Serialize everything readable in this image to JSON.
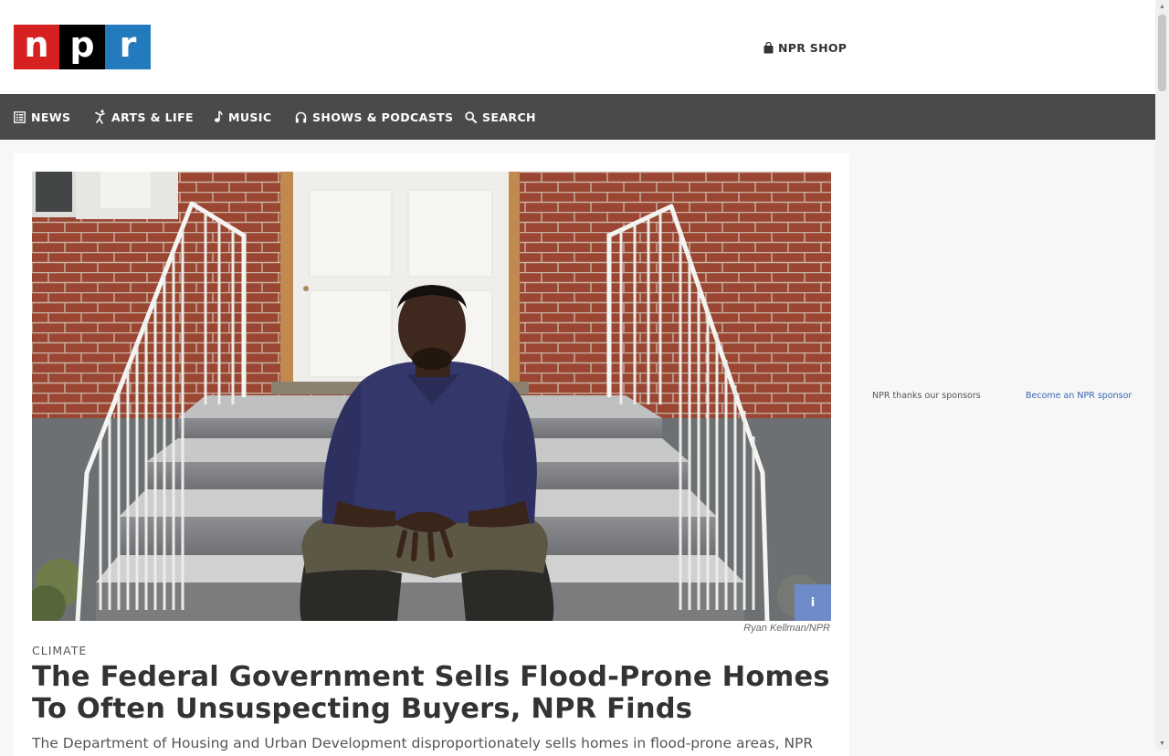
{
  "logo": {
    "letters": [
      "n",
      "p",
      "r"
    ]
  },
  "header": {
    "shop_label": "NPR SHOP",
    "shop_icon": "shopping-bag-icon"
  },
  "nav": {
    "items": [
      {
        "label": "NEWS",
        "icon": "news-icon"
      },
      {
        "label": "ARTS & LIFE",
        "icon": "dancer-icon"
      },
      {
        "label": "MUSIC",
        "icon": "music-note-icon"
      },
      {
        "label": "SHOWS & PODCASTS",
        "icon": "headphones-icon"
      },
      {
        "label": "SEARCH",
        "icon": "search-icon"
      }
    ]
  },
  "article": {
    "image_credit": "Ryan Kellman/NPR",
    "info_button_label": "i",
    "section": "CLIMATE",
    "headline": "The Federal Government Sells Flood-Prone Homes To Often Unsuspecting Buyers, NPR Finds",
    "teaser": "The Department of Housing and Urban Development disproportionately sells homes in flood-prone areas, NPR"
  },
  "sidebar": {
    "sponsor_text": "NPR thanks our sponsors",
    "sponsor_link": "Become an NPR sponsor"
  },
  "colors": {
    "logo_n": "#d62021",
    "logo_p": "#000000",
    "logo_r": "#237bbd",
    "nav_bg": "#4a4a4a",
    "info_button": "#6f8ac9",
    "link": "#3866b5"
  }
}
